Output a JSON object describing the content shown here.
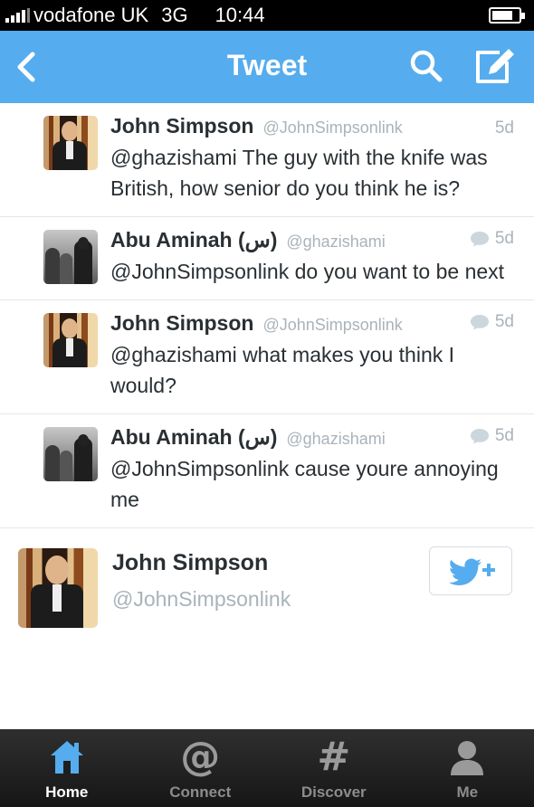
{
  "status_bar": {
    "carrier": "vodafone UK",
    "network": "3G",
    "time": "10:44"
  },
  "nav": {
    "title": "Tweet",
    "back_icon": "chevron-left-icon",
    "search_icon": "search-icon",
    "compose_icon": "compose-icon",
    "background_color": "#55acee"
  },
  "tweets": [
    {
      "name": "John Simpson",
      "handle": "@JohnSimpsonlink",
      "time": "5d",
      "text": "@ghazishami The guy with the knife was British, how senior do you think he is?",
      "has_reply_icon": false
    },
    {
      "name": "Abu Aminah (س)",
      "handle": "@ghazishami",
      "time": "5d",
      "text": "@JohnSimpsonlink do you want to be next",
      "has_reply_icon": true
    },
    {
      "name": "John Simpson",
      "handle": "@JohnSimpsonlink",
      "time": "5d",
      "text": "@ghazishami what makes you think I would?",
      "has_reply_icon": true
    },
    {
      "name": "Abu Aminah (س)",
      "handle": "@ghazishami",
      "time": "5d",
      "text": "@JohnSimpsonlink cause youre annoying me",
      "has_reply_icon": true
    }
  ],
  "profile_card": {
    "name": "John Simpson",
    "handle": "@JohnSimpsonlink",
    "follow_icon": "follow-bird-plus-icon"
  },
  "tabs": [
    {
      "label": "Home",
      "icon": "home-icon",
      "active": true
    },
    {
      "label": "Connect",
      "icon": "at-icon",
      "active": false
    },
    {
      "label": "Discover",
      "icon": "hash-icon",
      "active": false
    },
    {
      "label": "Me",
      "icon": "person-icon",
      "active": false
    }
  ]
}
